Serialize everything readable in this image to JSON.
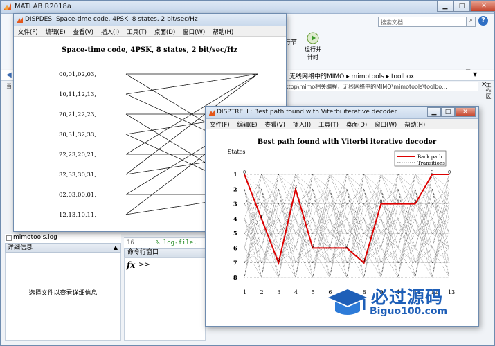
{
  "main": {
    "title": "MATLAB R2018a",
    "search_placeholder": "搜索文档",
    "toolbar": {
      "step_label": "行节",
      "run_label_1": "运行并",
      "run_label_2": "计时"
    },
    "address": "无线网络中的MIMO ▸ mimotools ▸ toolbox",
    "path_text": "ktop\\mimo相关编程，无线网络中的MIMO\\mimotools\\toolbo...",
    "workspace_tab": "工作区",
    "left_strip": "当",
    "file_item": "mimotools.log",
    "details_header": "详细信息",
    "details_text": "选择文件以查看详细信息",
    "editor": {
      "line_number": "16",
      "code": "%   log-file."
    },
    "command_window_title": "命令行窗口",
    "prompt": ">>"
  },
  "menu_items": [
    "文件(F)",
    "编辑(E)",
    "查看(V)",
    "插入(I)",
    "工具(T)",
    "桌面(D)",
    "窗口(W)",
    "帮助(H)"
  ],
  "fig1": {
    "window_title": "DISPDES: Space-time code, 4PSK, 8 states, 2 bit/sec/Hz",
    "plot_title": "Space-time code, 4PSK, 8 states, 2 bit/sec/Hz",
    "state_labels": [
      "00,01,02,03,",
      "10,11,12,13,",
      "20,21,22,23,",
      "30,31,32,33,",
      "22,23,20,21,",
      "32,33,30,31,",
      "02,03,00,01,",
      "12,13,10,11,"
    ]
  },
  "fig2": {
    "window_title": "DISPTRELL: Best path found with Viterbi iterative decoder",
    "plot_title": "Best path found with Viterbi iterative decoder",
    "ylabel": "States",
    "legend": [
      "Back path",
      "Transitions"
    ],
    "colors": {
      "back_path": "#dd0000",
      "transitions": "#222222"
    }
  },
  "chart_data": {
    "type": "line",
    "title": "Best path found with Viterbi iterative decoder",
    "ylabel": "States",
    "xlabel": "",
    "x": [
      1,
      2,
      3,
      4,
      5,
      6,
      7,
      8,
      9,
      10,
      11,
      12,
      13
    ],
    "y_ticks": [
      1,
      2,
      3,
      4,
      5,
      6,
      7,
      8
    ],
    "y_inverted": true,
    "xlim": [
      1,
      13
    ],
    "ylim": [
      1,
      8
    ],
    "legend_placement": "top-right",
    "series": [
      {
        "name": "Back path",
        "x": [
          1,
          2,
          3,
          4,
          5,
          6,
          7,
          8,
          9,
          10,
          11,
          12,
          13
        ],
        "values": [
          1,
          4,
          7,
          2,
          6,
          6,
          6,
          7,
          3,
          3,
          3,
          1,
          1
        ]
      }
    ],
    "transitions_per_state": 4,
    "states": 8
  },
  "watermark": {
    "cn": "必过源码",
    "url": "Biguo100.com"
  }
}
